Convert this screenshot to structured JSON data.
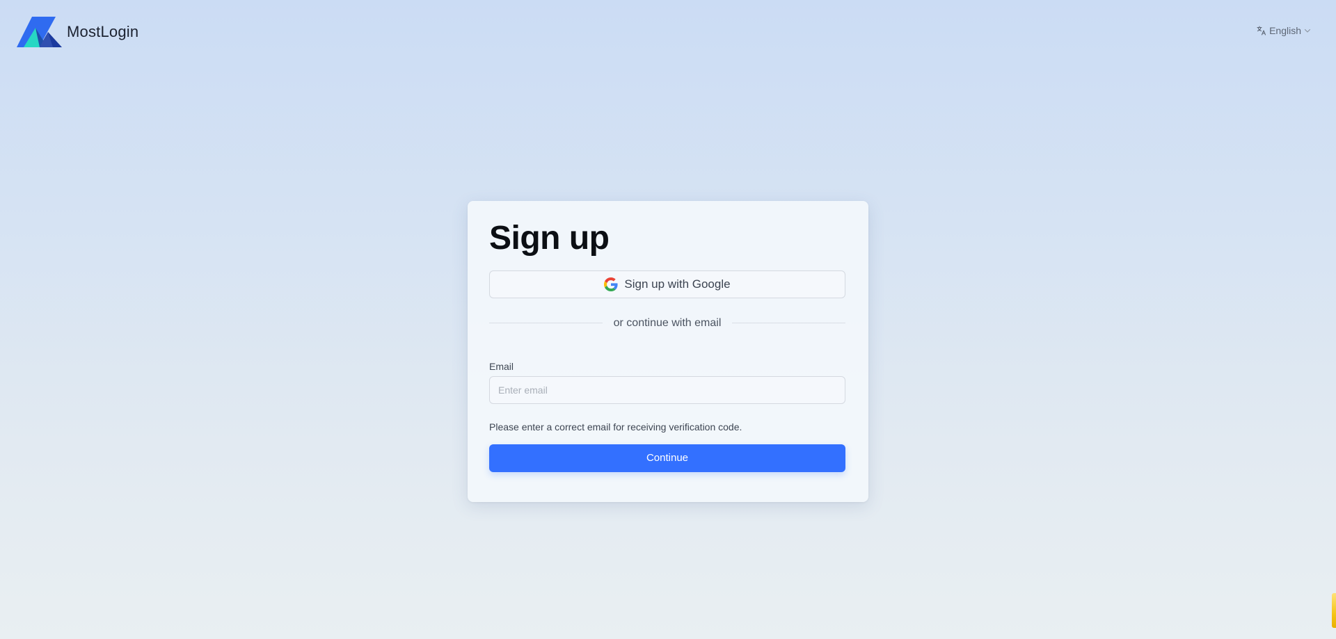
{
  "header": {
    "brand_name": "MostLogin",
    "logo_icon": "mostlogin-logo-icon",
    "language": {
      "icon": "translate-icon",
      "label": "English",
      "caret_icon": "chevron-down-icon"
    }
  },
  "signup": {
    "title": "Sign up",
    "google_button": {
      "icon": "google-icon",
      "label": "Sign up with Google"
    },
    "divider_text": "or continue with email",
    "email": {
      "label": "Email",
      "placeholder": "Enter email",
      "value": ""
    },
    "hint": "Please enter a correct email for receiving verification code.",
    "continue_label": "Continue"
  },
  "colors": {
    "accent": "#3370ff",
    "logo_blue": "#2f6bf0",
    "logo_dark": "#1e3fa8",
    "logo_teal": "#27d7c4"
  }
}
